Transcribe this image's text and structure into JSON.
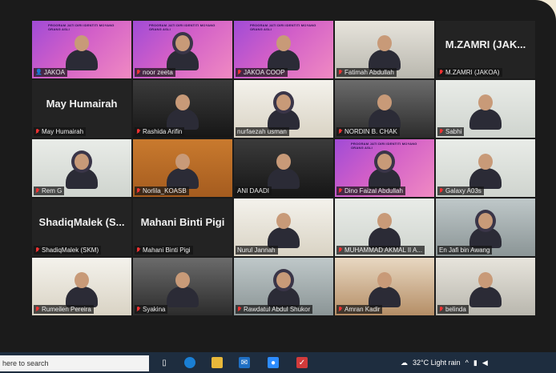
{
  "meeting": {
    "participants": [
      {
        "name": "JAKOA",
        "card": "",
        "video": "banner",
        "active": true,
        "muted": false,
        "banner_text": "PROGRAM JATI DIRI IDENTITI MOYANG ORANG ASLI"
      },
      {
        "name": "noor zeeta",
        "card": "",
        "video": "banner",
        "muted": true,
        "banner_text": "PROGRAM JATI DIRI IDENTITI MOYANG ORANG ASLI"
      },
      {
        "name": "JAKOA COOP",
        "card": "",
        "video": "banner",
        "muted": true,
        "banner_text": "PROGRAM JATI DIRI IDENTITI MOYANG ORANG ASLI"
      },
      {
        "name": "Fatimah Abdullah",
        "card": "",
        "video": "room-f",
        "muted": true
      },
      {
        "name": "M.ZAMRI (JAKOA)",
        "card": "M.ZAMRI  (JAK...",
        "video": "card",
        "muted": true
      },
      {
        "name": "May Humairah",
        "card": "May Humairah",
        "video": "card",
        "muted": true
      },
      {
        "name": "Rashida Arifin",
        "card": "",
        "video": "room-b",
        "muted": true
      },
      {
        "name": "nurfaezah usman",
        "card": "",
        "video": "room-c",
        "muted": false
      },
      {
        "name": "NORDIN B. CHAK",
        "card": "",
        "video": "room-e",
        "muted": true
      },
      {
        "name": "Sabhi",
        "card": "",
        "video": "room-a",
        "muted": true
      },
      {
        "name": "Rem G",
        "card": "",
        "video": "room-a",
        "muted": true
      },
      {
        "name": "Norlila_KOASB",
        "card": "",
        "video": "room-d",
        "muted": true
      },
      {
        "name": "ANI DAADI",
        "card": "",
        "video": "room-b",
        "muted": false
      },
      {
        "name": "Dino Faizal Abdullah",
        "card": "",
        "video": "banner",
        "muted": true,
        "banner_text": "PROGRAM JATI DIRI IDENTITI MOYANG ORANG ASLI"
      },
      {
        "name": "Galaxy A03s",
        "card": "",
        "video": "room-a",
        "muted": true
      },
      {
        "name": "ShadiqMalek (SKM)",
        "card": "ShadiqMalek  (S...",
        "video": "card",
        "muted": true
      },
      {
        "name": "Mahani Binti Pigi",
        "card": "Mahani Binti Pigi",
        "video": "card",
        "muted": true
      },
      {
        "name": "Nurul Jannah",
        "card": "",
        "video": "room-c",
        "muted": false
      },
      {
        "name": "MUHAMMAD AKMAL II A...",
        "card": "",
        "video": "room-a",
        "muted": true
      },
      {
        "name": "En Jafi bin Awang",
        "card": "",
        "video": "room-g",
        "muted": false
      },
      {
        "name": "Rumeilen Pereira",
        "card": "",
        "video": "room-c",
        "muted": true
      },
      {
        "name": "Syakina",
        "card": "",
        "video": "room-e",
        "muted": true
      },
      {
        "name": "Rawdatul Abdul Shukor",
        "card": "",
        "video": "room-g",
        "muted": true
      },
      {
        "name": "Amran Kadir",
        "card": "",
        "video": "room-h",
        "muted": true
      },
      {
        "name": "belinda",
        "card": "",
        "video": "room-f",
        "muted": true
      }
    ]
  },
  "taskbar": {
    "search_placeholder": "here to search",
    "weather": "32°C  Light rain",
    "icons": [
      "task-view-icon",
      "edge-icon",
      "file-explorer-icon",
      "mail-icon",
      "zoom-icon",
      "app-icon"
    ]
  },
  "colors": {
    "background": "#1b1b1b",
    "tile": "#232323",
    "active_border": "#d8e64a",
    "muted_mic": "#e33333",
    "taskbar": "#1e2d3f"
  }
}
